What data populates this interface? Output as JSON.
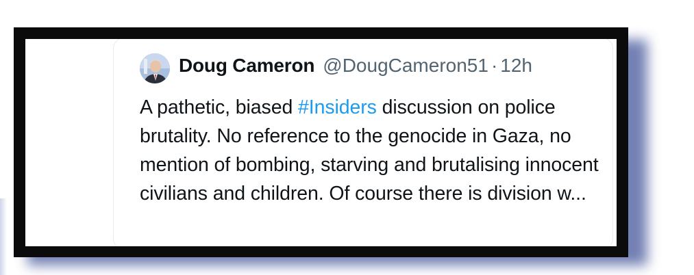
{
  "tweet": {
    "display_name": "Doug Cameron",
    "handle": "@DougCameron51",
    "separator": "·",
    "time": "12h",
    "text_before": "A pathetic, biased ",
    "hashtag": "#Insiders",
    "text_after": " discussion on police brutality. No reference to the genocide in Gaza, no mention of bombing, starving and brutalising innocent civilians and children. Of course there is division w..."
  },
  "icons": {
    "avatar": "profile-avatar"
  },
  "colors": {
    "frame": "#0b0b0b",
    "shadow": "#5b6aa6",
    "hashtag": "#1d9bf0",
    "handle": "#536471",
    "text": "#0f1419"
  }
}
